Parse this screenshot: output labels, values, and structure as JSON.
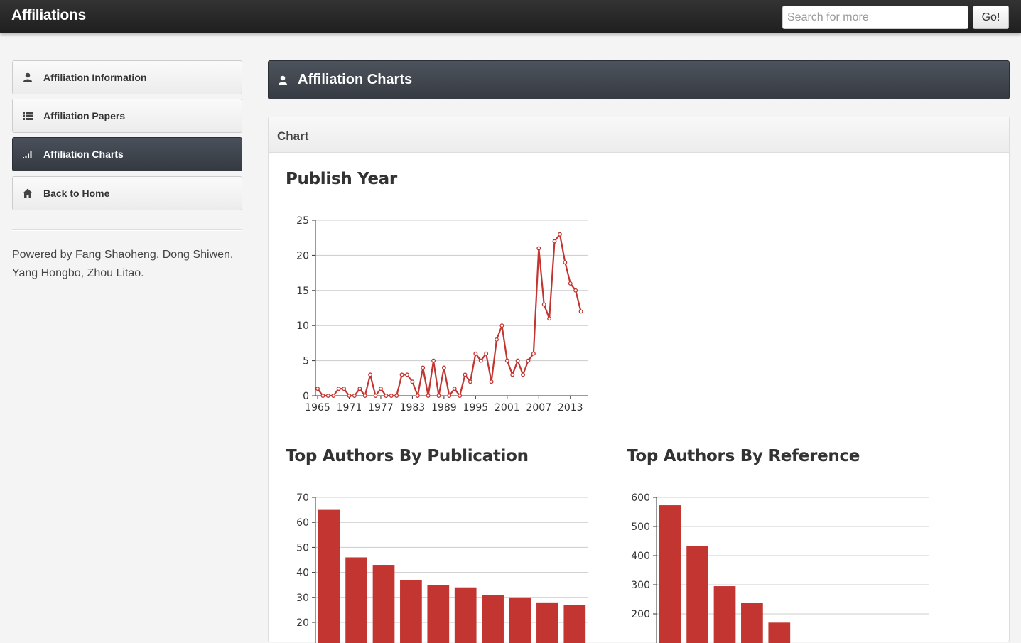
{
  "navbar": {
    "brand": "Affiliations",
    "search_placeholder": "Search for more",
    "go_label": "Go!"
  },
  "sidebar": {
    "items": [
      {
        "label": "Affiliation Information",
        "icon": "user-icon",
        "active": false
      },
      {
        "label": "Affiliation Papers",
        "icon": "list-icon",
        "active": false
      },
      {
        "label": "Affiliation Charts",
        "icon": "signal-icon",
        "active": true
      },
      {
        "label": "Back to Home",
        "icon": "home-icon",
        "active": false
      }
    ],
    "credits": "Powered by Fang Shaoheng, Dong Shiwen, Yang Hongbo, Zhou Litao."
  },
  "main": {
    "header_title": "Affiliation Charts",
    "panel_title": "Chart"
  },
  "colors": {
    "series": "#c23531",
    "active_bg": "#3e434b"
  },
  "chart_data": [
    {
      "type": "line",
      "title": "Publish Year",
      "x": [
        1965,
        1966,
        1967,
        1968,
        1969,
        1970,
        1971,
        1972,
        1973,
        1974,
        1975,
        1976,
        1977,
        1978,
        1979,
        1980,
        1981,
        1982,
        1983,
        1984,
        1985,
        1986,
        1987,
        1988,
        1989,
        1990,
        1991,
        1992,
        1993,
        1994,
        1995,
        1996,
        1997,
        1998,
        1999,
        2000,
        2001,
        2002,
        2003,
        2004,
        2005,
        2006,
        2007,
        2008,
        2009,
        2010,
        2011,
        2012,
        2013,
        2014,
        2015,
        2016
      ],
      "values": [
        1,
        0,
        0,
        0,
        1,
        1,
        0,
        0,
        1,
        0,
        3,
        0,
        1,
        0,
        0,
        0,
        3,
        3,
        2,
        0,
        4,
        0,
        5,
        0,
        4,
        0,
        1,
        0,
        3,
        2,
        6,
        5,
        6,
        2,
        8,
        10,
        5,
        3,
        5,
        3,
        5,
        6,
        21,
        13,
        11,
        22,
        23,
        19,
        16,
        15,
        12,
        null
      ],
      "x_ticks": [
        "1965",
        "1971",
        "1977",
        "1983",
        "1989",
        "1995",
        "2001",
        "2007",
        "2013"
      ],
      "ylim": [
        0,
        25
      ],
      "y_ticks": [
        0,
        5,
        10,
        15,
        20,
        25
      ],
      "grid": true
    },
    {
      "type": "bar",
      "title": "Top Authors By Publication",
      "values": [
        65,
        46,
        43,
        37,
        35,
        34,
        31,
        30,
        28,
        27
      ],
      "ylim": [
        0,
        70
      ],
      "y_ticks": [
        20,
        30,
        40,
        50,
        60,
        70
      ],
      "grid": true
    },
    {
      "type": "bar",
      "title": "Top Authors By Reference",
      "values": [
        573,
        432,
        295,
        237,
        170,
        0,
        0,
        0,
        0,
        0
      ],
      "ylim": [
        0,
        600
      ],
      "y_ticks": [
        200,
        300,
        400,
        500,
        600
      ],
      "grid": true
    }
  ]
}
